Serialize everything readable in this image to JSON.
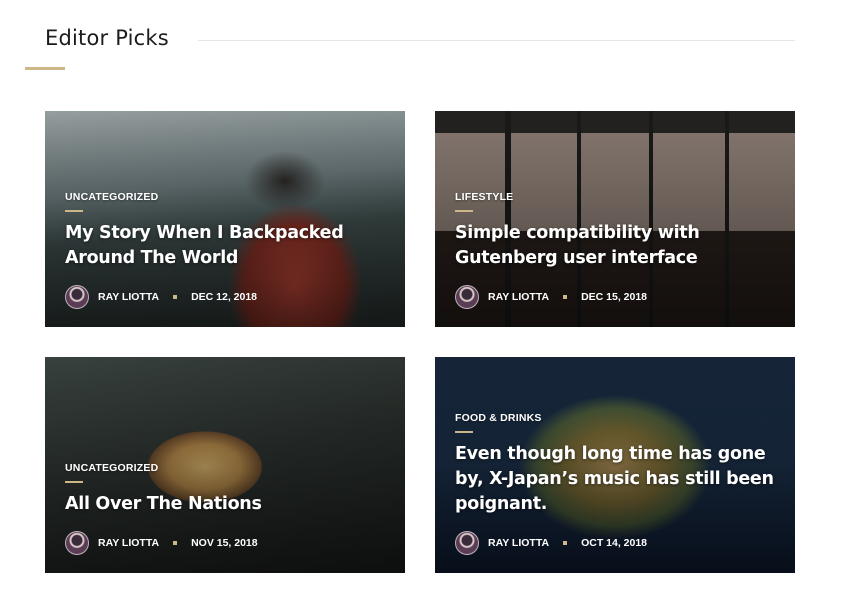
{
  "section": {
    "title": "Editor Picks"
  },
  "colors": {
    "accent": "#cdb787",
    "rule": "#e6e6e6"
  },
  "cards": [
    {
      "category": "UNCATEGORIZED",
      "title": "My Story When I Backpacked Around The World",
      "author": "RAY LIOTTA",
      "date": "DEC 12, 2018"
    },
    {
      "category": "LIFESTYLE",
      "title": "Simple compatibility with Gutenberg user interface",
      "author": "RAY LIOTTA",
      "date": "DEC 15, 2018"
    },
    {
      "category": "UNCATEGORIZED",
      "title": "All Over The Nations",
      "author": "RAY LIOTTA",
      "date": "NOV 15, 2018"
    },
    {
      "category": "FOOD & DRINKS",
      "title": "Even though long time has gone by, X-Japan’s music has still been poignant.",
      "author": "RAY LIOTTA",
      "date": "OCT 14, 2018"
    }
  ]
}
